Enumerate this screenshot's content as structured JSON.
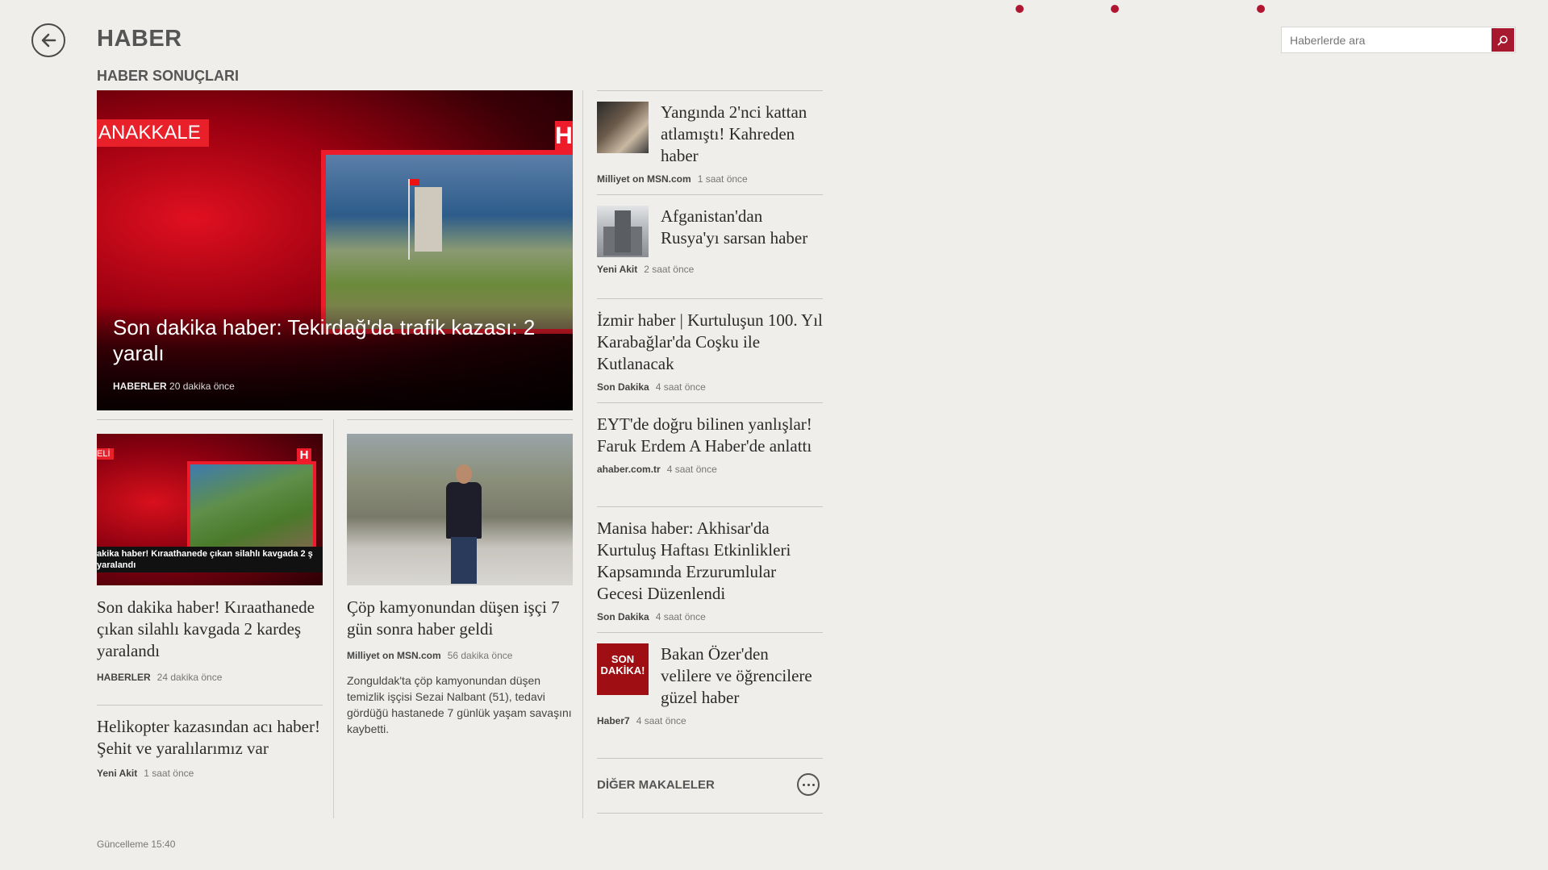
{
  "header": {
    "title": "HABER",
    "section": "HABER SONUÇLARI",
    "search_placeholder": "Haberlerde ara"
  },
  "colors": {
    "accent": "#a6192e",
    "background": "#efeeea"
  },
  "hero": {
    "overlay_tag": "ANAKKALE",
    "logo_letter": "H",
    "title": "Son dakika haber: Tekirdağ'da trafik kazası: 2 yaralı",
    "source": "HABERLER",
    "time": "20 dakika önce"
  },
  "left_column": [
    {
      "thumb_tag": "ELİ",
      "thumb_caption": "akika haber! Kıraathanede çıkan silahlı kavgada 2 ş yaralandı",
      "title": "Son dakika haber! Kıraathanede çıkan silahlı kavgada 2 kardeş yaralandı",
      "source": "HABERLER",
      "time": "24 dakika önce"
    },
    {
      "title": "Helikopter kazasından acı haber! Şehit ve yaralılarımız var",
      "source": "Yeni Akit",
      "time": "1 saat önce"
    }
  ],
  "middle_column": {
    "title": "Çöp kamyonundan düşen işçi 7 gün sonra haber geldi",
    "source": "Milliyet on MSN.com",
    "time": "56 dakika önce",
    "description": "Zonguldak'ta çöp kamyonundan düşen temizlik işçisi Sezai Nalbant (51), tedavi gördüğü hastanede 7 günlük yaşam savaşını kaybetti."
  },
  "right_column": [
    {
      "title": "Yangında 2'nci kattan atlamıştı! Kahreden haber",
      "source": "Milliyet on MSN.com",
      "time": "1 saat önce"
    },
    {
      "title": "Afganistan'dan Rusya'yı sarsan haber",
      "source": "Yeni Akit",
      "time": "2 saat önce"
    },
    {
      "title": "İzmir haber | Kurtuluşun 100. Yıl Karabağlar'da Coşku ile Kutlanacak",
      "source": "Son Dakika",
      "time": "4 saat önce"
    },
    {
      "title": "EYT'de doğru bilinen yanlışlar! Faruk Erdem A Haber'de anlattı",
      "source": "ahaber.com.tr",
      "time": "4 saat önce"
    },
    {
      "title": "Manisa haber: Akhisar'da Kurtuluş Haftası Etkinlikleri Kapsamında Erzurumlular Gecesi Düzenlendi",
      "source": "Son Dakika",
      "time": "4 saat önce"
    },
    {
      "title": "Bakan Özer'den velilere ve öğrencilere güzel haber",
      "source": "Haber7",
      "time": "4 saat önce",
      "thumb_text": "SON DAKİKA!"
    }
  ],
  "more_articles": "DİĞER MAKALELER",
  "footer": "Güncelleme 15:40"
}
